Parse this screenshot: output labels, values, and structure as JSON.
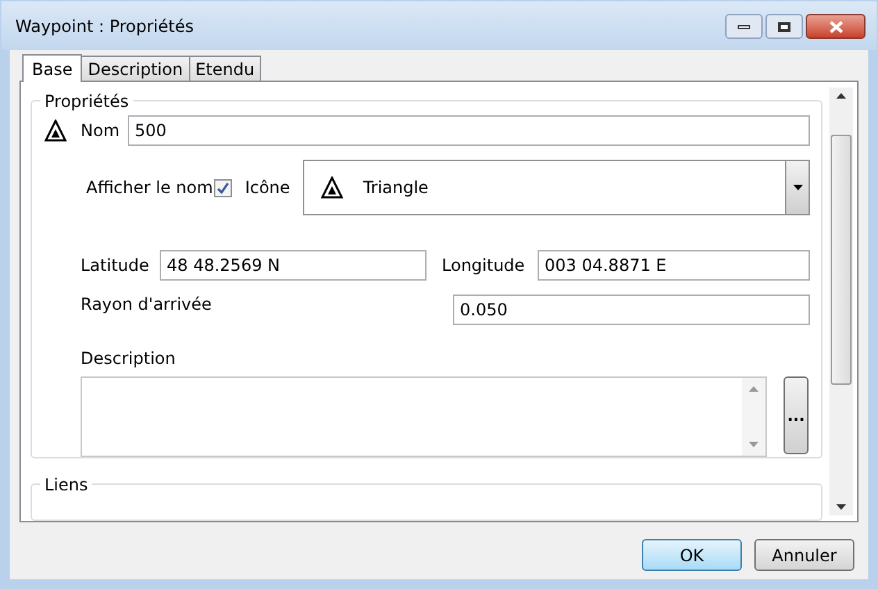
{
  "window": {
    "title": "Waypoint : Propriétés"
  },
  "tabs": [
    {
      "label": "Base",
      "selected": true
    },
    {
      "label": "Description",
      "selected": false
    },
    {
      "label": "Etendu",
      "selected": false
    }
  ],
  "properties": {
    "title": "Propriétés",
    "name_label": "Nom",
    "name_value": "500",
    "show_name_label": "Afficher le nom",
    "show_name_checked": true,
    "icon_label": "Icône",
    "icon_value": "Triangle",
    "latitude_label": "Latitude",
    "latitude_value": "48 48.2569 N",
    "longitude_label": "Longitude",
    "longitude_value": "003 04.8871 E",
    "radius_label": "Rayon d'arrivée",
    "radius_value": "0.050",
    "description_label": "Description",
    "more_button": "..."
  },
  "links": {
    "title": "Liens"
  },
  "buttons": [
    {
      "label": "OK",
      "kind": "default"
    },
    {
      "label": "Annuler",
      "kind": "normal"
    }
  ]
}
